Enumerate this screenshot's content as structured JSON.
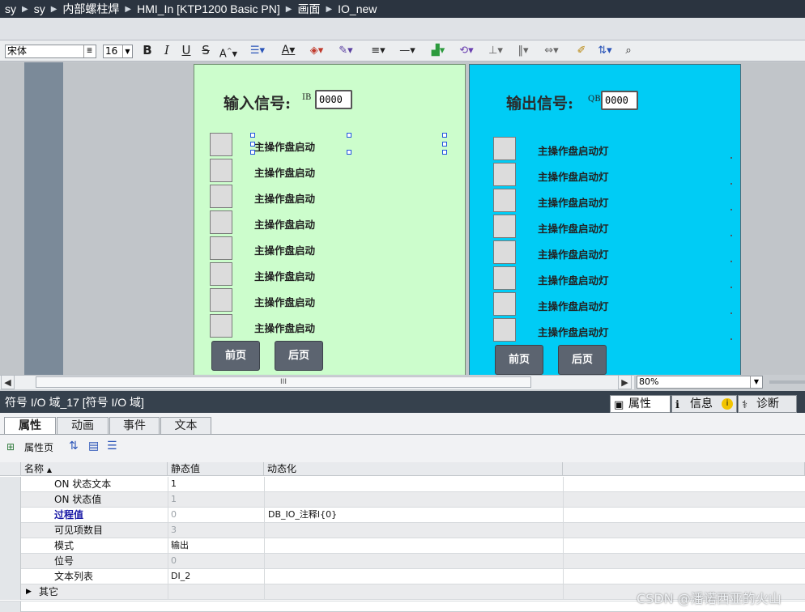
{
  "breadcrumb": [
    "sy",
    "sy",
    "内部螺柱焊",
    "HMI_In [KTP1200 Basic PN]",
    "画面",
    "IO_new"
  ],
  "toolbar": {
    "font_name": "宋体",
    "font_size": "16",
    "bold": "B",
    "italic": "I",
    "underline": "U",
    "strike": "S"
  },
  "screen_input": {
    "title": "输入信号:",
    "addr_prefix": "IB",
    "value": "0000",
    "signals": [
      "主操作盘启动",
      "主操作盘启动",
      "主操作盘启动",
      "主操作盘启动",
      "主操作盘启动",
      "主操作盘启动",
      "主操作盘启动",
      "主操作盘启动"
    ],
    "prev_label": "前页",
    "next_label": "后页"
  },
  "screen_output": {
    "title": "输出信号:",
    "addr_prefix": "QB",
    "value": "0000",
    "signals": [
      "主操作盘启动灯",
      "主操作盘启动灯",
      "主操作盘启动灯",
      "主操作盘启动灯",
      "主操作盘启动灯",
      "主操作盘启动灯",
      "主操作盘启动灯",
      "主操作盘启动灯"
    ],
    "prev_label": "前页",
    "next_label": "后页"
  },
  "scroll": {
    "thumb_label": "III",
    "zoom": "80%"
  },
  "inspector": {
    "title": "符号 I/O 域_17 [符号 I/O 域]",
    "tabs": [
      "属性",
      "信息",
      "诊断"
    ],
    "sub_tabs": [
      "属性",
      "动画",
      "事件",
      "文本"
    ],
    "props_page_label": "属性页",
    "columns": {
      "name": "名称",
      "static": "静态值",
      "dynamic": "动态化"
    },
    "rows": [
      {
        "name": "ON 状态文本",
        "static": "1",
        "dynamic": ""
      },
      {
        "name": "ON 状态值",
        "static": "1",
        "dynamic": ""
      },
      {
        "name": "过程值",
        "static": "0",
        "dynamic": "DB_IO_注释I{0}"
      },
      {
        "name": "可见项数目",
        "static": "3",
        "dynamic": ""
      },
      {
        "name": "模式",
        "static": "输出",
        "dynamic": ""
      },
      {
        "name": "位号",
        "static": "0",
        "dynamic": ""
      },
      {
        "name": "文本列表",
        "static": "DI_2",
        "dynamic": ""
      },
      {
        "name": "其它",
        "static": "",
        "dynamic": ""
      }
    ]
  },
  "watermark": "CSDN @潘诺西亚的火山"
}
